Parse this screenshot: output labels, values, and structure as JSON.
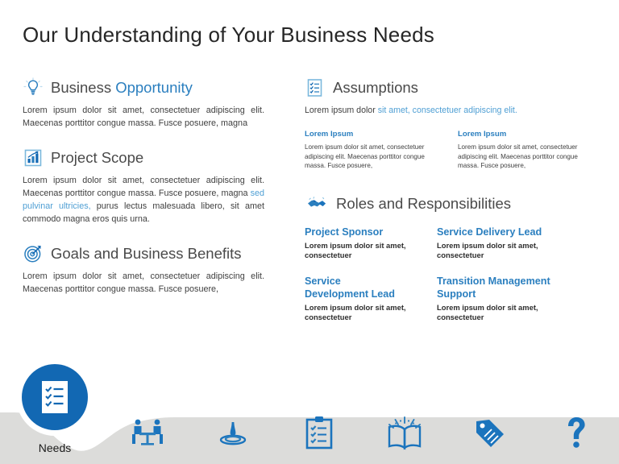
{
  "slide": {
    "title": "Our Understanding  of Your Business  Needs",
    "accent_blue": "#2b7fbf",
    "light_blue": "#4f9fd4",
    "circle_blue": "#1268b3",
    "banner_gray": "#dcdcda",
    "heading_gray": "#4a4a4a"
  },
  "left_column": {
    "sections": [
      {
        "icon": "lightbulb-icon",
        "title_dark": "Business",
        "title_accent": "Opportunity",
        "body": "Lorem ipsum dolor sit amet, consectetuer adipiscing elit. Maecenas porttitor congue massa. Fusce posuere, magna"
      },
      {
        "icon": "bar-chart-icon",
        "title_dark": "Project Scope",
        "title_accent": "",
        "body_pre": "Lorem ipsum dolor sit amet, consectetuer adipiscing elit. Maecenas porttitor congue massa. Fusce posuere, magna ",
        "body_highlight": "sed pulvinar ultricies,",
        "body_post": " purus lectus malesuada libero, sit amet commodo magna eros quis urna."
      },
      {
        "icon": "target-icon",
        "title_dark": "Goals and Business Benefits",
        "title_accent": "",
        "body": "Lorem ipsum dolor sit amet, consectetuer adipiscing elit. Maecenas porttitor congue massa. Fusce posuere,"
      }
    ]
  },
  "right_column": {
    "assumptions": {
      "icon": "checklist-icon",
      "title": "Assumptions",
      "lead_dark": "Lorem ipsum dolor ",
      "lead_accent": "sit amet, consectetuer adipiscing elit.",
      "sub_items": [
        {
          "heading": "Lorem Ipsum",
          "body": "Lorem ipsum dolor sit amet, consectetuer adipiscing elit. Maecenas porttitor congue massa. Fusce posuere,"
        },
        {
          "heading": "Lorem Ipsum",
          "body": "Lorem ipsum dolor sit amet, consectetuer adipiscing elit. Maecenas porttitor congue massa. Fusce posuere,"
        }
      ]
    },
    "roles": {
      "icon": "handshake-icon",
      "title": "Roles and Responsibilities",
      "items": [
        {
          "title": "Project Sponsor",
          "body": "Lorem ipsum dolor sit amet, consectetuer"
        },
        {
          "title": "Service Delivery Lead",
          "body": "Lorem ipsum dolor sit amet, consectetuer"
        },
        {
          "title": "Service Development Lead",
          "body": "Lorem ipsum dolor sit amet, consectetuer"
        },
        {
          "title": "Transition Management Support",
          "body": "Lorem ipsum dolor sit amet, consectetuer"
        }
      ]
    }
  },
  "footer": {
    "active_item": {
      "icon": "checklist-clipboard-icon",
      "label": "Needs"
    },
    "nav_icons": [
      {
        "icon": "meeting-table-icon"
      },
      {
        "icon": "water-ripple-icon"
      },
      {
        "icon": "clipboard-icon"
      },
      {
        "icon": "open-book-icon"
      },
      {
        "icon": "price-tag-icon"
      },
      {
        "icon": "question-mark-icon"
      }
    ]
  }
}
